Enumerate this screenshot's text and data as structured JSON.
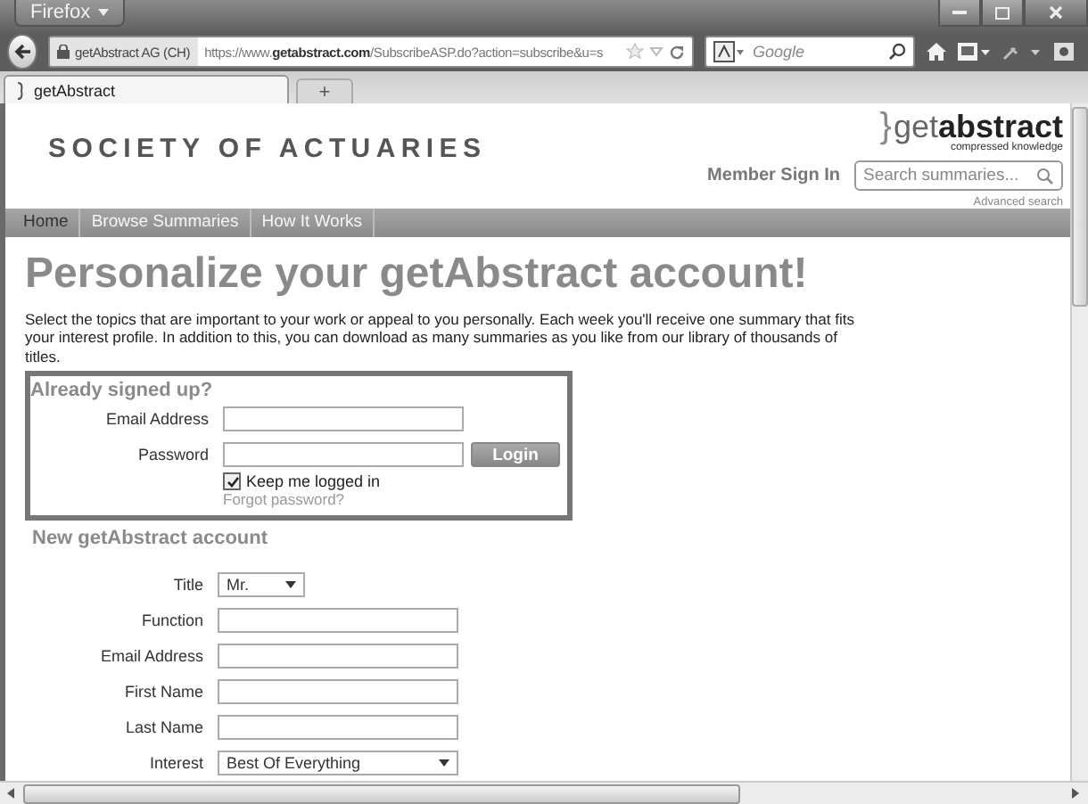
{
  "browser": {
    "menu_button": "Firefox",
    "identity": "getAbstract AG (CH)",
    "url": "https://www.**getabstract.com**/SubscribeASP.do?action=subscribe&u=s",
    "search_placeholder": "Google",
    "tabs": [
      {
        "label": "getAbstract",
        "selected": true
      }
    ],
    "new_tab": "+"
  },
  "header": {
    "organization": "SOCIETY OF ACTUARIES",
    "logo_bracket": "}",
    "logo": "get**abstract**",
    "tagline": "compressed knowledge",
    "member_sign_in": "Member Sign In",
    "search_placeholder": "Search summaries...",
    "advanced_search": "Advanced search"
  },
  "nav": [
    {
      "label": "Home",
      "selected": true
    },
    {
      "label": "Browse Summaries",
      "selected": false
    },
    {
      "label": "How It Works",
      "selected": false
    }
  ],
  "heading": "Personalize your getAbstract account!",
  "intro": "Select the topics that are important to your work or appeal to you personally. Each week you'll receive one summary that fits your interest profile. In addition to this, you can download as many summaries as you like from our library of thousands of titles.",
  "login": {
    "title": "Already signed up?",
    "fields": [
      {
        "label": "Email Address"
      },
      {
        "label": "Password"
      }
    ],
    "button": "Login",
    "keep_logged_in": {
      "label": "Keep me logged in",
      "checked": true
    },
    "forgot": "Forgot password?"
  },
  "new_account": {
    "title": "New getAbstract account",
    "fields": [
      {
        "label": "Title",
        "kind": "select",
        "value": "Mr."
      },
      {
        "label": "Function",
        "kind": "text"
      },
      {
        "label": "Email Address",
        "kind": "text"
      },
      {
        "label": "First Name",
        "kind": "text"
      },
      {
        "label": "Last Name",
        "kind": "text"
      },
      {
        "label": "Interest",
        "kind": "select",
        "value": "Best Of Everything"
      }
    ]
  }
}
